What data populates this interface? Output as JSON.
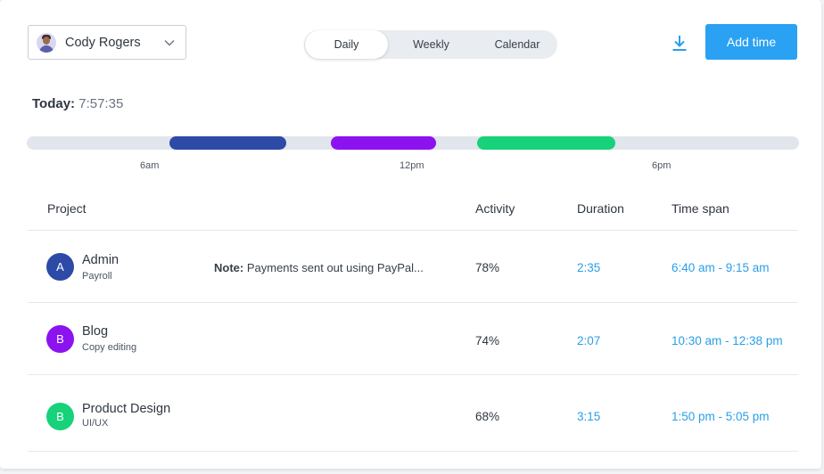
{
  "user": {
    "name": "Cody Rogers",
    "avatar_icon": "user-avatar"
  },
  "view_tabs": [
    {
      "label": "Daily",
      "active": true
    },
    {
      "label": "Weekly",
      "active": false
    },
    {
      "label": "Calendar",
      "active": false
    }
  ],
  "actions": {
    "download_icon": "download-icon",
    "add_time_label": "Add time"
  },
  "today": {
    "label": "Today:",
    "value": "7:57:35"
  },
  "timeline": {
    "ticks": [
      "6am",
      "12pm",
      "6pm"
    ],
    "segments": [
      {
        "project": "Admin",
        "color": "#2c4aa6"
      },
      {
        "project": "Blog",
        "color": "#8c12f0"
      },
      {
        "project": "Product Design",
        "color": "#17d27a"
      }
    ]
  },
  "table": {
    "headers": {
      "project": "Project",
      "activity": "Activity",
      "duration": "Duration",
      "time_span": "Time span"
    },
    "rows": [
      {
        "initial": "A",
        "color": "#2c4aa6",
        "name": "Admin",
        "sub": "Payroll",
        "note_label": "Note:",
        "note_text": "Payments sent out using PayPal...",
        "activity": "78%",
        "duration": "2:35",
        "time_span": "6:40 am - 9:15 am"
      },
      {
        "initial": "B",
        "color": "#8c12f0",
        "name": "Blog",
        "sub": "Copy editing",
        "note_label": "",
        "note_text": "",
        "activity": "74%",
        "duration": "2:07",
        "time_span": "10:30 am - 12:38 pm"
      },
      {
        "initial": "B",
        "color": "#17d27a",
        "name": "Product Design",
        "sub": "UI/UX",
        "note_label": "",
        "note_text": "",
        "activity": "68%",
        "duration": "3:15",
        "time_span": "1:50 pm - 5:05 pm"
      }
    ]
  }
}
